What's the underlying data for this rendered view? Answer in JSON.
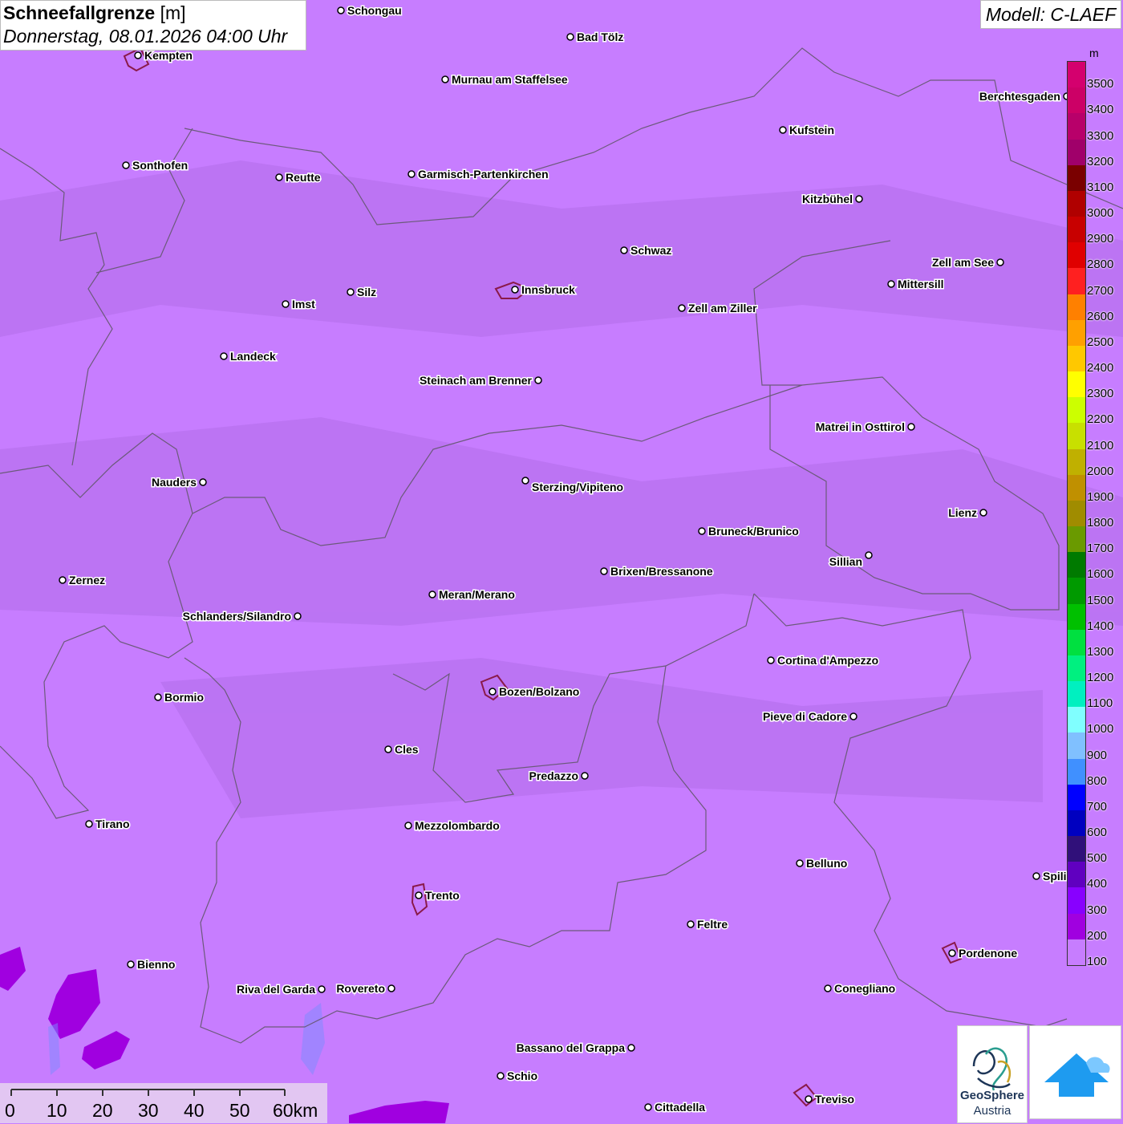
{
  "title": {
    "parameter": "Schneefallgrenze",
    "unit": "[m]",
    "datetime": "Donnerstag, 08.01.2026 04:00 Uhr"
  },
  "model": "Modell: C-LAEF",
  "legend": {
    "unit": "m",
    "levels": [
      {
        "label": "3500",
        "color": "#d4006e"
      },
      {
        "label": "3400",
        "color": "#cc0066"
      },
      {
        "label": "3300",
        "color": "#b8006a"
      },
      {
        "label": "3200",
        "color": "#a0006a"
      },
      {
        "label": "3100",
        "color": "#7a0000"
      },
      {
        "label": "3000",
        "color": "#b00000"
      },
      {
        "label": "2900",
        "color": "#c80000"
      },
      {
        "label": "2800",
        "color": "#e00000"
      },
      {
        "label": "2700",
        "color": "#ff2020"
      },
      {
        "label": "2600",
        "color": "#ff8000"
      },
      {
        "label": "2500",
        "color": "#ffa000"
      },
      {
        "label": "2400",
        "color": "#ffc800"
      },
      {
        "label": "2300",
        "color": "#ffff00"
      },
      {
        "label": "2200",
        "color": "#ccff00"
      },
      {
        "label": "2100",
        "color": "#c8e000"
      },
      {
        "label": "2000",
        "color": "#c0b000"
      },
      {
        "label": "1900",
        "color": "#c09000"
      },
      {
        "label": "1800",
        "color": "#a08c00"
      },
      {
        "label": "1700",
        "color": "#6a9a00"
      },
      {
        "label": "1600",
        "color": "#007a00"
      },
      {
        "label": "1500",
        "color": "#009a00"
      },
      {
        "label": "1400",
        "color": "#00c000"
      },
      {
        "label": "1300",
        "color": "#00e040"
      },
      {
        "label": "1200",
        "color": "#00f080"
      },
      {
        "label": "1100",
        "color": "#00f0c0"
      },
      {
        "label": "1000",
        "color": "#80ffff"
      },
      {
        "label": "900",
        "color": "#80c0ff"
      },
      {
        "label": "800",
        "color": "#4090ff"
      },
      {
        "label": "700",
        "color": "#0000ff"
      },
      {
        "label": "600",
        "color": "#0000c0"
      },
      {
        "label": "500",
        "color": "#30107a"
      },
      {
        "label": "400",
        "color": "#6000c0"
      },
      {
        "label": "300",
        "color": "#8800ff"
      },
      {
        "label": "200",
        "color": "#a000e0"
      },
      {
        "label": "100",
        "color": "#c77dff"
      }
    ]
  },
  "scale_bar": {
    "labels": [
      "0",
      "10",
      "20",
      "30",
      "40",
      "50",
      "60km"
    ]
  },
  "logos": {
    "geosphere_line1": "GeoSphere",
    "geosphere_line2": "Austria"
  },
  "cities": [
    {
      "name": "Schongau"
    },
    {
      "name": "Bad Tölz"
    },
    {
      "name": "Kempten"
    },
    {
      "name": "Murnau am Staffelsee"
    },
    {
      "name": "Sonthofen"
    },
    {
      "name": "Reutte"
    },
    {
      "name": "Garmisch-Partenkirchen"
    },
    {
      "name": "Kufstein"
    },
    {
      "name": "Berchtesgaden"
    },
    {
      "name": "Kitzbühel"
    },
    {
      "name": "Schwaz"
    },
    {
      "name": "Zell am See"
    },
    {
      "name": "Mittersill"
    },
    {
      "name": "Imst"
    },
    {
      "name": "Silz"
    },
    {
      "name": "Innsbruck"
    },
    {
      "name": "Zell am Ziller"
    },
    {
      "name": "Landeck"
    },
    {
      "name": "Steinach am Brenner"
    },
    {
      "name": "Matrei in Osttirol"
    },
    {
      "name": "Nauders"
    },
    {
      "name": "Sterzing/Vipiteno"
    },
    {
      "name": "Lienz"
    },
    {
      "name": "Bruneck/Brunico"
    },
    {
      "name": "Sillian"
    },
    {
      "name": "Zernez"
    },
    {
      "name": "Brixen/Bressanone"
    },
    {
      "name": "Meran/Merano"
    },
    {
      "name": "Schlanders/Silandro"
    },
    {
      "name": "Cortina d'Ampezzo"
    },
    {
      "name": "Bormio"
    },
    {
      "name": "Bozen/Bolzano"
    },
    {
      "name": "Pieve di Cadore"
    },
    {
      "name": "Cles"
    },
    {
      "name": "Predazzo"
    },
    {
      "name": "Tirano"
    },
    {
      "name": "Mezzolombardo"
    },
    {
      "name": "Belluno"
    },
    {
      "name": "Spili"
    },
    {
      "name": "Trento"
    },
    {
      "name": "Feltre"
    },
    {
      "name": "Pordenone"
    },
    {
      "name": "Bienno"
    },
    {
      "name": "Riva del Garda"
    },
    {
      "name": "Rovereto"
    },
    {
      "name": "Conegliano"
    },
    {
      "name": "Bassano del Grappa"
    },
    {
      "name": "Schio"
    },
    {
      "name": "Treviso"
    },
    {
      "name": "Cittadella"
    }
  ]
}
